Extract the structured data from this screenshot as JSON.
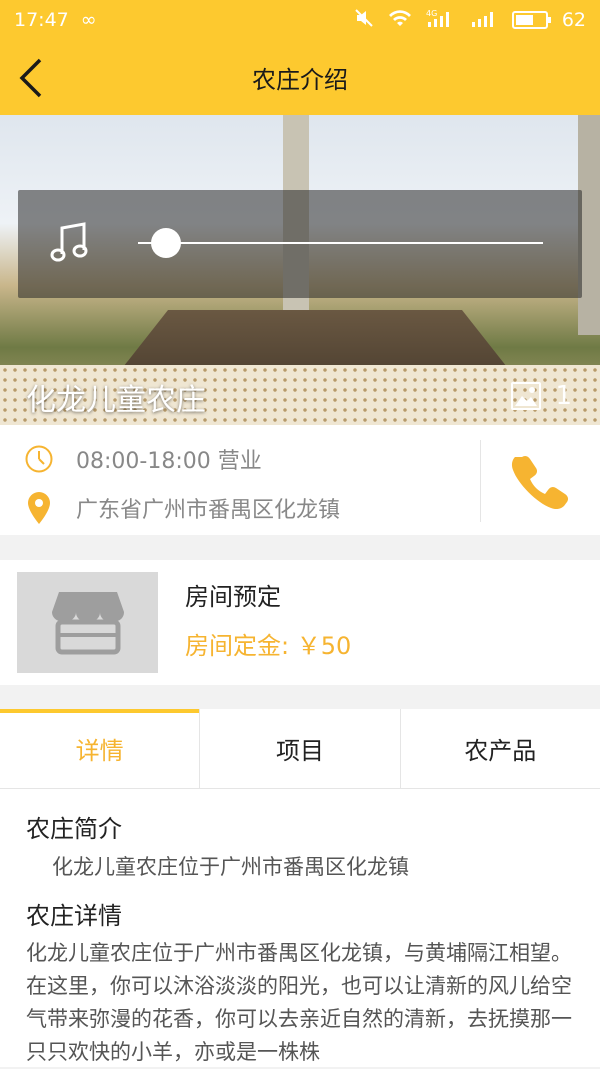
{
  "status_bar": {
    "time": "17:47",
    "infinity": "∞",
    "battery": "62",
    "battery_level": 0.62,
    "signal_label": "4G"
  },
  "header": {
    "title": "农庄介绍"
  },
  "hero": {
    "farm_name": "化龙儿童农庄",
    "photo_count": "1",
    "audio_progress": 0.07
  },
  "info": {
    "hours": "08:00-18:00 营业",
    "address": "广东省广州市番禺区化龙镇"
  },
  "booking": {
    "name": "房间预定",
    "price": "房间定金: ￥50"
  },
  "tabs": [
    {
      "label": "详情"
    },
    {
      "label": "项目"
    },
    {
      "label": "农产品"
    }
  ],
  "details": {
    "intro_heading": "农庄简介",
    "intro_text": "化龙儿童农庄位于广州市番禺区化龙镇",
    "detail_heading": "农庄详情",
    "detail_text": "化龙儿童农庄位于广州市番禺区化龙镇，与黄埔隔江相望。在这里，你可以沐浴淡淡的阳光，也可以让清新的风儿给空气带来弥漫的花香，你可以去亲近自然的清新，去抚摸那一只只欢快的小羊，亦或是一株株"
  },
  "colors": {
    "accent": "#fdc92f",
    "price": "#f6b431"
  }
}
